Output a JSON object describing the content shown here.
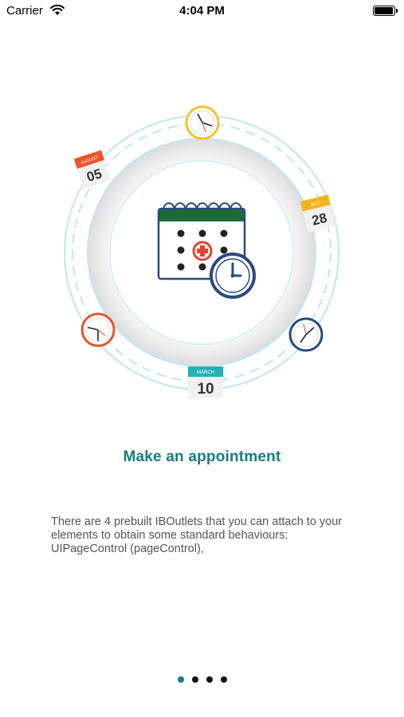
{
  "status_bar": {
    "carrier": "Carrier",
    "time": "4:04 PM"
  },
  "illustration": {
    "calendar_cards": [
      {
        "month": "AUGUST",
        "day": "05",
        "color": "#e8562a"
      },
      {
        "month": "JULY",
        "day": "28",
        "color": "#f2b51d"
      },
      {
        "month": "MARCH",
        "day": "10",
        "color": "#26b1b3"
      }
    ],
    "colors": {
      "ring": "#bfe6f5",
      "navy": "#2a4a7f",
      "green": "#1e6b3a",
      "red": "#e5432b",
      "yellow": "#f2c22e"
    }
  },
  "onboarding": {
    "title": "Make an appointment",
    "description": "There are 4 prebuilt IBOutlets that you can attach to your elements to obtain some standard behaviours: UIPageControl (pageControl),"
  },
  "page_control": {
    "count": 4,
    "current": 1
  }
}
